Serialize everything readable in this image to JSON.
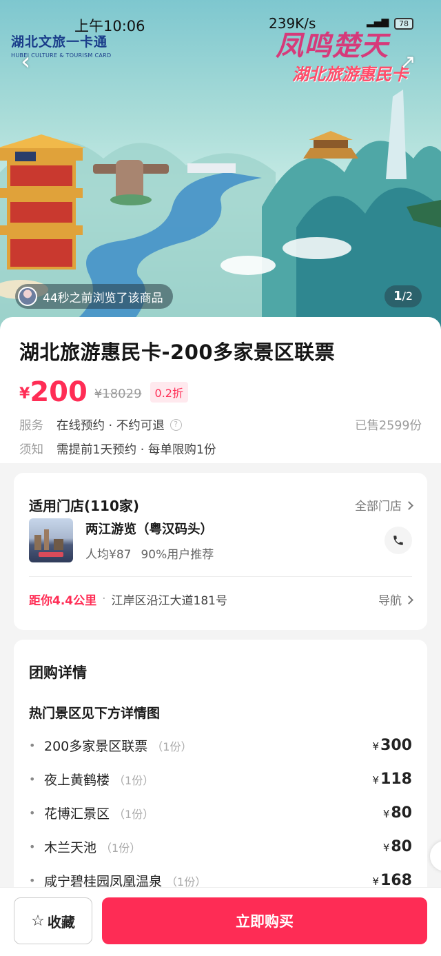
{
  "status_bar": {
    "time": "上午10:06",
    "network_speed": "239K/s",
    "battery": "78",
    "signal": "6"
  },
  "hero": {
    "logo_left_cn": "湖北文旅一卡通",
    "logo_left_en": "HUBEI CULTURE & TOURISM CARD",
    "logo_right_line1": "凤鸣楚天",
    "logo_right_line2": "湖北旅游惠民卡",
    "viewer_text": "44秒之前浏览了该商品",
    "pager_current": "1",
    "pager_total": "/2"
  },
  "product": {
    "title": "湖北旅游惠民卡-200多家景区联票",
    "price_currency": "¥",
    "price": "200",
    "original_price": "¥18029",
    "discount": "0.2折",
    "service_label": "服务",
    "service_value": "在线预约 · 不约可退",
    "sold": "已售2599份",
    "notice_label": "须知",
    "notice_value": "需提前1天预约 · 每单限购1份"
  },
  "stores": {
    "heading": "适用门店(110家)",
    "all_link": "全部门店",
    "store_name": "两江游览（粤汉码头）",
    "avg_price": "人均¥87",
    "recommend": "90%用户推荐",
    "distance": "距你4.4公里",
    "address": "江岸区沿江大道181号",
    "navigate": "导航"
  },
  "detail": {
    "heading": "团购详情",
    "subheading": "热门景区见下方详情图",
    "items": [
      {
        "name": "200多家景区联票",
        "qty": "（1份）",
        "price": "300"
      },
      {
        "name": "夜上黄鹤楼",
        "qty": "（1份）",
        "price": "118"
      },
      {
        "name": "花博汇景区",
        "qty": "（1份）",
        "price": "80"
      },
      {
        "name": "木兰天池",
        "qty": "（1份）",
        "price": "80"
      },
      {
        "name": "咸宁碧桂园凤凰温泉",
        "qty": "（1份）",
        "price": "168"
      }
    ],
    "currency": "¥"
  },
  "bottom_bar": {
    "favorite_label": "收藏",
    "buy_label": "立即购买"
  },
  "colors": {
    "accent": "#fe2c55",
    "price": "#ff2d55"
  }
}
